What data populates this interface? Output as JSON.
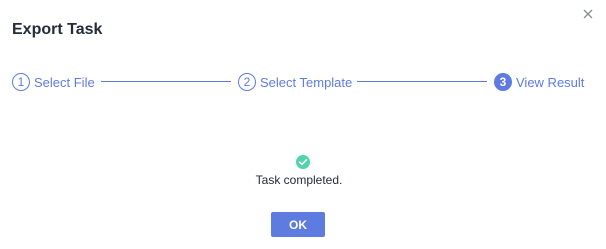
{
  "dialog": {
    "title": "Export Task"
  },
  "steps": [
    {
      "number": "1",
      "label": "Select File",
      "state": "done"
    },
    {
      "number": "2",
      "label": "Select Template",
      "state": "done"
    },
    {
      "number": "3",
      "label": "View Result",
      "state": "active"
    }
  ],
  "result": {
    "icon": "check-circle-icon",
    "message": "Task completed."
  },
  "footer": {
    "ok_label": "OK"
  },
  "colors": {
    "accent": "#5e7ce0",
    "success": "#50d4ab",
    "text": "#252b3a"
  }
}
